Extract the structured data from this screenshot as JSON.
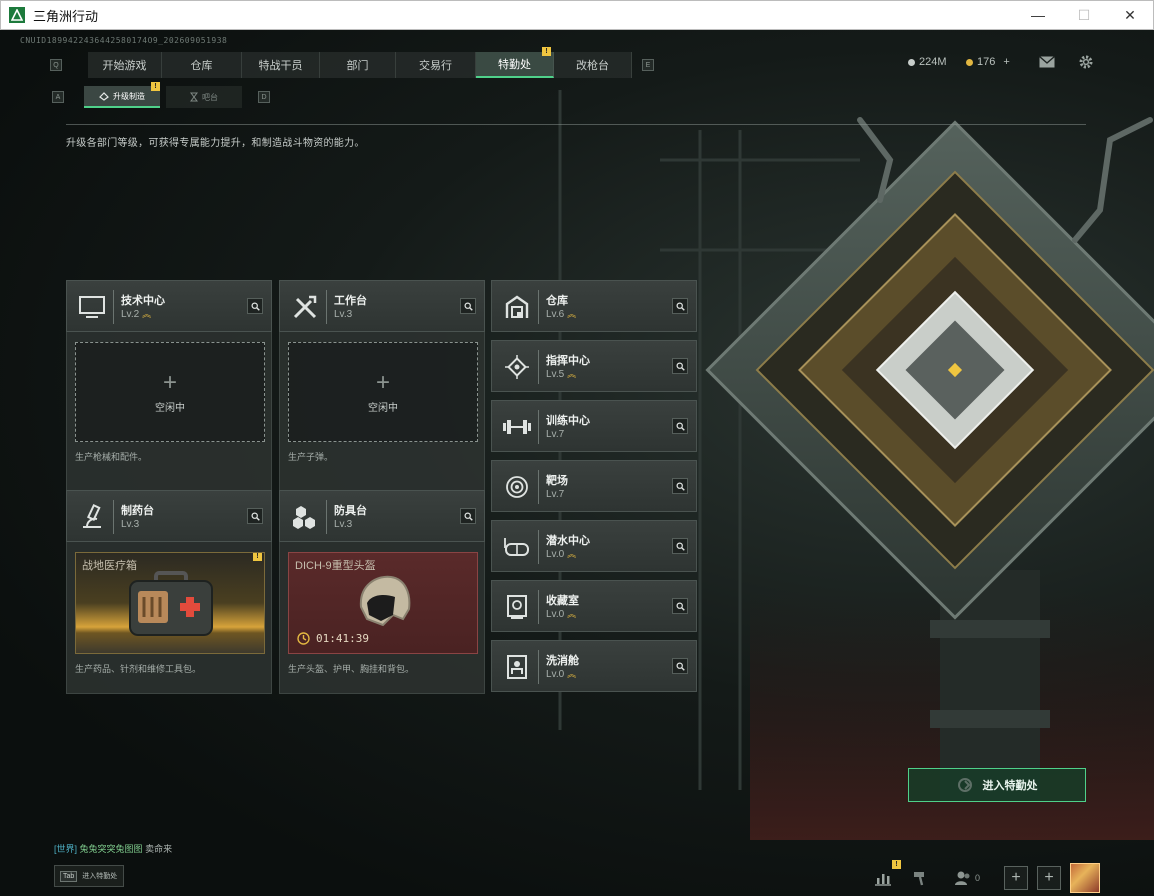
{
  "window": {
    "title": "三角洲行动",
    "minimize": "—",
    "maximize": "☐",
    "close": "✕"
  },
  "uid": "CNUID1899422436442580174O9_202609051938",
  "nav": {
    "left_key": "Q",
    "right_key": "E",
    "tabs": [
      {
        "label": "开始游戏"
      },
      {
        "label": "仓库"
      },
      {
        "label": "特战干员"
      },
      {
        "label": "部门"
      },
      {
        "label": "交易行"
      },
      {
        "label": "特勤处",
        "active": true,
        "badge": "!"
      },
      {
        "label": "改枪台"
      }
    ]
  },
  "currency": {
    "coupons": "224M",
    "coins": "176",
    "add": "+"
  },
  "subnav": {
    "left_key": "A",
    "right_key": "D",
    "tabs": [
      {
        "label": "升级制造",
        "active": true,
        "badge": "!"
      },
      {
        "label": "吧台"
      }
    ]
  },
  "description": "升级各部门等级，可获得专属能力提升，和制造战斗物资的能力。",
  "cards": {
    "tech": {
      "name": "技术中心",
      "level": "Lv.2",
      "status": "空闲中",
      "note": "生产枪械和配件。"
    },
    "workbench": {
      "name": "工作台",
      "level": "Lv.3",
      "status": "空闲中",
      "note": "生产子弹。"
    },
    "pharmacy": {
      "name": "制药台",
      "level": "Lv.3",
      "slot_title": "战地医疗箱",
      "badge": "!",
      "note": "生产药品、针剂和维修工具包。"
    },
    "armor": {
      "name": "防具台",
      "level": "Lv.3",
      "slot_title": "DICH-9重型头盔",
      "timer": "01:41:39",
      "note": "生产头盔、护甲、胸挂和背包。"
    }
  },
  "facilities": [
    {
      "name": "仓库",
      "level": "Lv.6",
      "upgradable": true,
      "icon": "storage-icon"
    },
    {
      "name": "指挥中心",
      "level": "Lv.5",
      "upgradable": true,
      "icon": "chip-icon"
    },
    {
      "name": "训练中心",
      "level": "Lv.7",
      "upgradable": false,
      "icon": "dumbbell-icon"
    },
    {
      "name": "靶场",
      "level": "Lv.7",
      "upgradable": false,
      "icon": "target-icon"
    },
    {
      "name": "潜水中心",
      "level": "Lv.0",
      "upgradable": true,
      "icon": "diving-mask-icon"
    },
    {
      "name": "收藏室",
      "level": "Lv.0",
      "upgradable": true,
      "icon": "vault-icon"
    },
    {
      "name": "洗消舱",
      "level": "Lv.0",
      "upgradable": true,
      "icon": "decon-icon"
    }
  ],
  "enter_button": "进入特勤处",
  "chat": {
    "channel": "[世界]",
    "user": "兔兔突突兔图图",
    "message": "卖命来"
  },
  "tab_hint": {
    "key": "Tab",
    "label": "进入特勤处"
  },
  "bottom": {
    "stats_badge": "!",
    "friends_count": "0",
    "add1": "+",
    "add2": "+"
  },
  "colors": {
    "accent_green": "#4fd18a",
    "badge_yellow": "#f0c640",
    "upgrade_gold": "#e2b741"
  }
}
